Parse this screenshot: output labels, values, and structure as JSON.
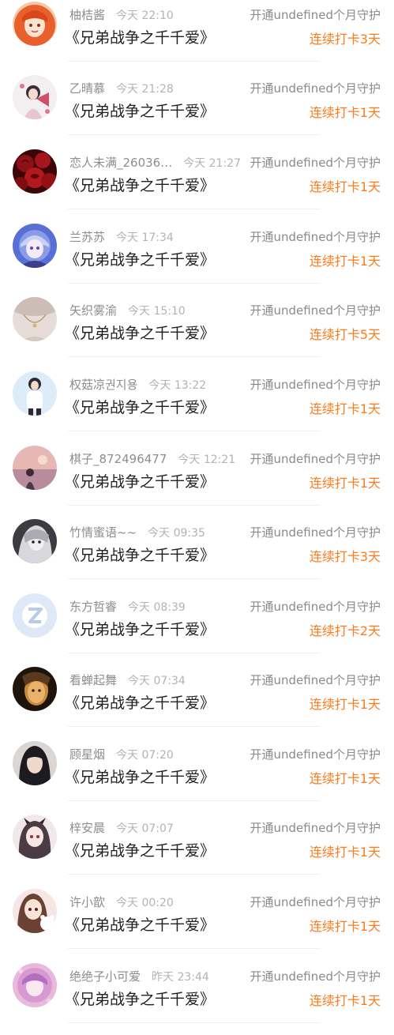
{
  "rows": [
    {
      "name": "柚桔酱",
      "time": "今天 22:10",
      "title": "《兄弟战争之千千爱》",
      "action": "开通undefined个月守护",
      "streak": "连续打卡3天",
      "avatar_icon": "avatar-orange-hair-girl-icon"
    },
    {
      "name": "乙晴慕",
      "time": "今天 21:28",
      "title": "《兄弟战争之千千爱》",
      "action": "开通undefined个月守护",
      "streak": "连续打卡1天",
      "avatar_icon": "avatar-girl-with-fan-icon"
    },
    {
      "name": "恋人未满_26036…",
      "time": "今天 21:27",
      "title": "《兄弟战争之千千爱》",
      "action": "开通undefined个月守护",
      "streak": "连续打卡1天",
      "avatar_icon": "avatar-red-roses-icon"
    },
    {
      "name": "兰苏苏",
      "time": "今天 17:34",
      "title": "《兄弟战争之千千爱》",
      "action": "开通undefined个月守护",
      "streak": "连续打卡1天",
      "avatar_icon": "avatar-anime-boy-icon"
    },
    {
      "name": "矢织雾渝",
      "time": "今天 15:10",
      "title": "《兄弟战争之千千爱》",
      "action": "开通undefined个月守护",
      "streak": "连续打卡5天",
      "avatar_icon": "avatar-necklace-icon"
    },
    {
      "name": "权菇凉권지용",
      "time": "今天 13:22",
      "title": "《兄弟战争之千千爱》",
      "action": "开通undefined个月守护",
      "streak": "连续打卡1天",
      "avatar_icon": "avatar-person-white-icon"
    },
    {
      "name": "棋子_872496477",
      "time": "今天 12:21",
      "title": "《兄弟战争之千千爱》",
      "action": "开通undefined个月守护",
      "streak": "连续打卡1天",
      "avatar_icon": "avatar-sunset-girl-icon"
    },
    {
      "name": "竹情蜜语~~",
      "time": "今天 09:35",
      "title": "《兄弟战争之千千爱》",
      "action": "开通undefined个月守护",
      "streak": "连续打卡3天",
      "avatar_icon": "avatar-dark-anime-icon"
    },
    {
      "name": "东方哲睿",
      "time": "今天 08:39",
      "title": "《兄弟战争之千千爱》",
      "action": "开通undefined个月守护",
      "streak": "连续打卡2天",
      "avatar_icon": "avatar-default-z-icon"
    },
    {
      "name": "看蝉起舞",
      "time": "今天 07:34",
      "title": "《兄弟战争之千千爱》",
      "action": "开通undefined个月守护",
      "streak": "连续打卡1天",
      "avatar_icon": "avatar-golden-face-icon"
    },
    {
      "name": "顾星烟",
      "time": "今天 07:20",
      "title": "《兄弟战争之千千爱》",
      "action": "开通undefined个月守护",
      "streak": "连续打卡1天",
      "avatar_icon": "avatar-dark-hair-girl-icon"
    },
    {
      "name": "梓安晨",
      "time": "今天 07:07",
      "title": "《兄弟战争之千千爱》",
      "action": "开通undefined个月守护",
      "streak": "连续打卡1天",
      "avatar_icon": "avatar-gothic-anime-icon"
    },
    {
      "name": "许小歆",
      "time": "今天 00:20",
      "title": "《兄弟战争之千千爱》",
      "action": "开通undefined个月守护",
      "streak": "连续打卡1天",
      "avatar_icon": "avatar-cute-girl-bear-icon"
    },
    {
      "name": "绝绝子小可爱",
      "time": "昨天 23:44",
      "title": "《兄弟战争之千千爱》",
      "action": "开通undefined个月守护",
      "streak": "连续打卡1天",
      "avatar_icon": "avatar-pink-anime-icon"
    }
  ],
  "colors": {
    "streak": "#ff7a1a",
    "name": "#8d8d8d",
    "time": "#b3b3b3",
    "title": "#1f1f1f",
    "action": "#8a8a8a"
  }
}
